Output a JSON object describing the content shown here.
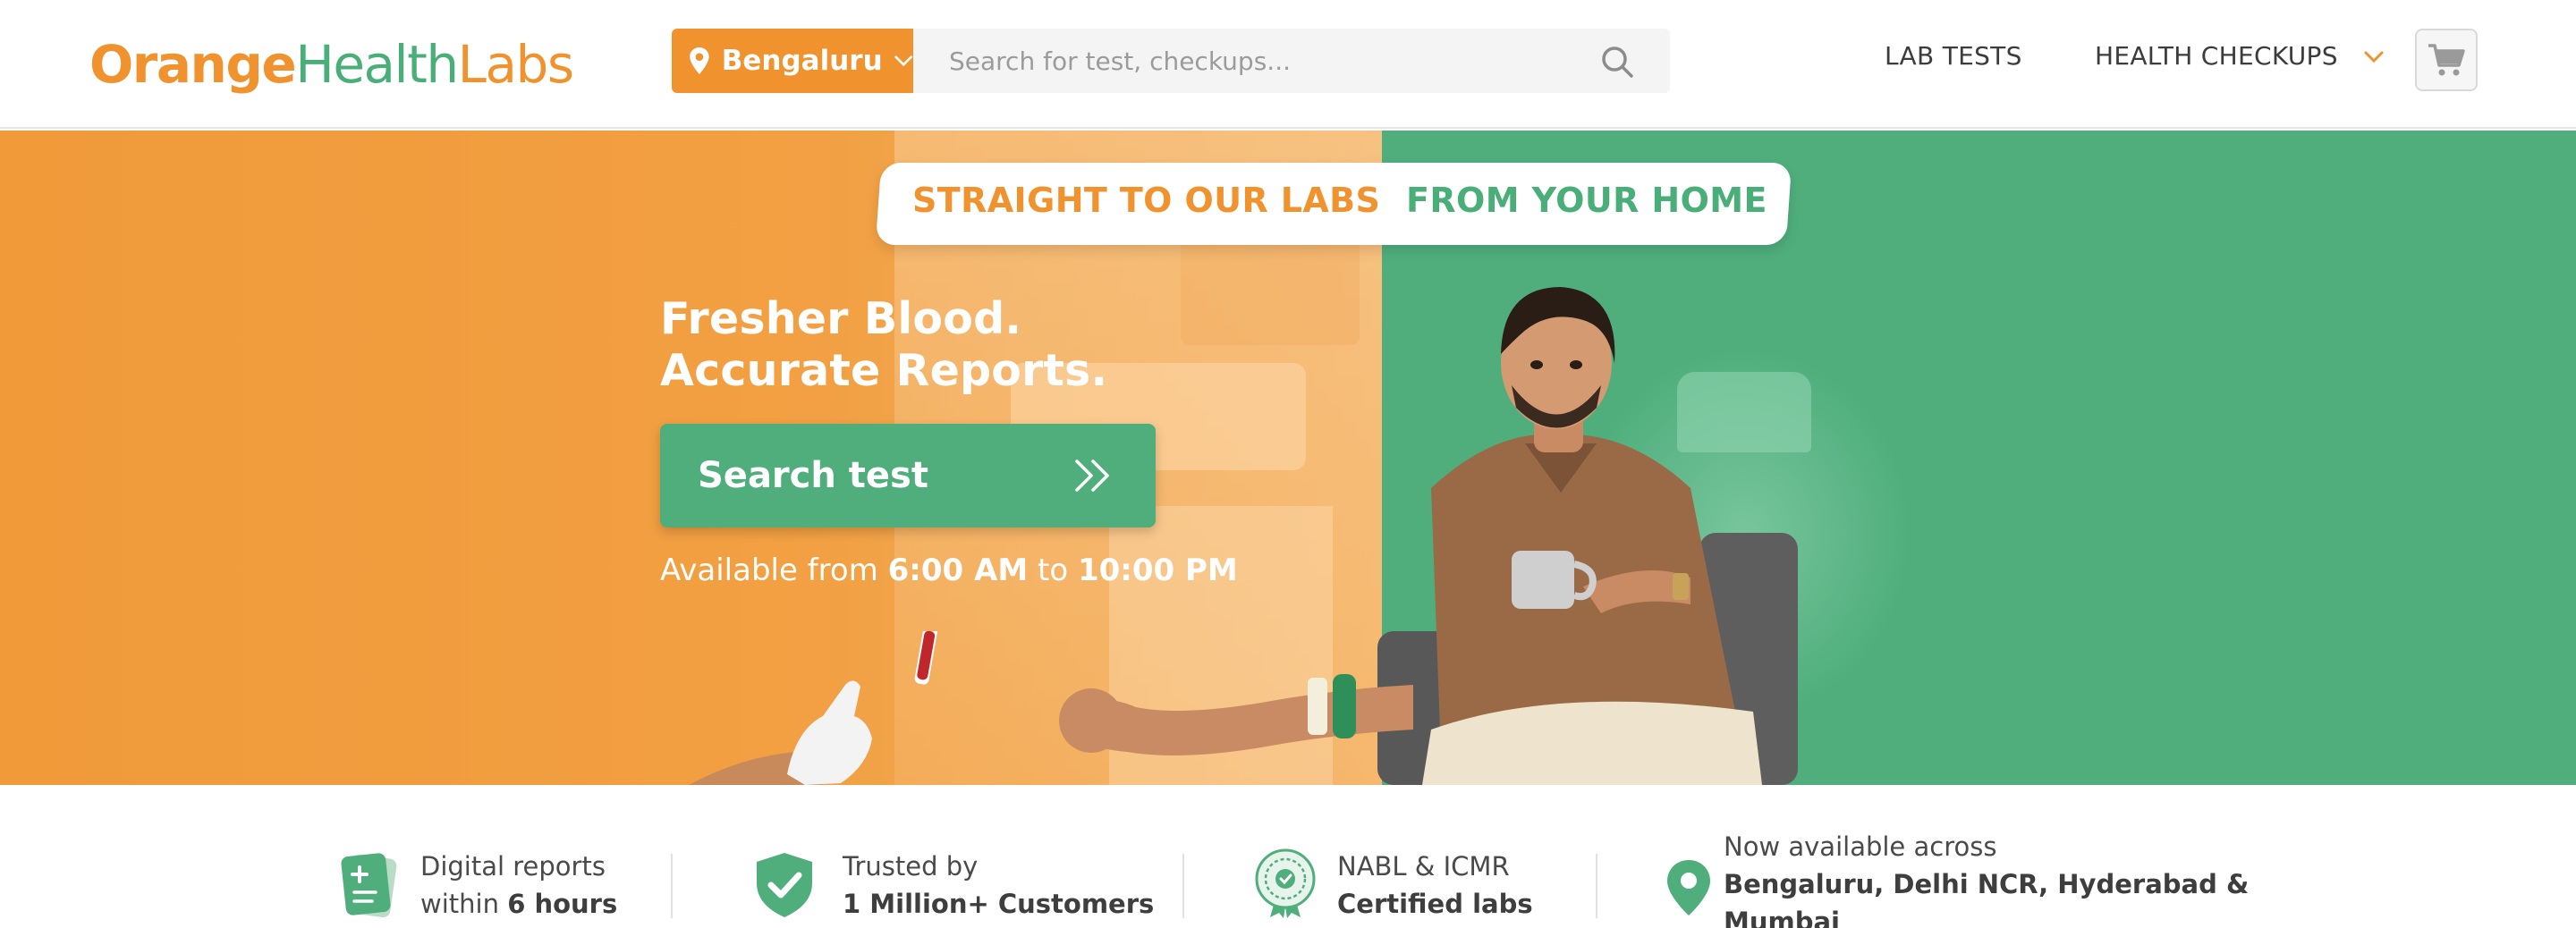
{
  "header": {
    "logo": {
      "part1": "Orange",
      "part2": "Health",
      "part3": "Labs"
    },
    "city": "Bengaluru",
    "search_placeholder": "Search for test, checkups...",
    "nav": {
      "lab_tests": "LAB TESTS",
      "health_checkups": "HEALTH CHECKUPS"
    }
  },
  "hero": {
    "banner_left": "STRAIGHT TO OUR LABS",
    "banner_right": "FROM YOUR HOME",
    "headline_line1": "Fresher Blood.",
    "headline_line2": "Accurate Reports.",
    "cta_label": "Search test",
    "availability": {
      "prefix": "Available from ",
      "start": "6:00 AM",
      "mid": " to ",
      "end": "10:00 PM"
    }
  },
  "features": [
    {
      "icon": "digital-report-icon",
      "line1": "Digital reports",
      "line2_prefix": "within ",
      "line2_bold": "6 hours"
    },
    {
      "icon": "shield-check-icon",
      "line1": "Trusted by",
      "line2_bold": "1 Million+ Customers"
    },
    {
      "icon": "certification-badge-icon",
      "line1": "NABL & ICMR",
      "line2_bold": "Certified labs"
    },
    {
      "icon": "location-pin-icon",
      "line1": "Now available across",
      "line2_bold": "Bengaluru, Delhi NCR, Hyderabad &",
      "line3_bold": "Mumbai"
    }
  ],
  "colors": {
    "orange": "#f0932f",
    "green": "#4fae7c",
    "text": "#3a3a3a"
  }
}
